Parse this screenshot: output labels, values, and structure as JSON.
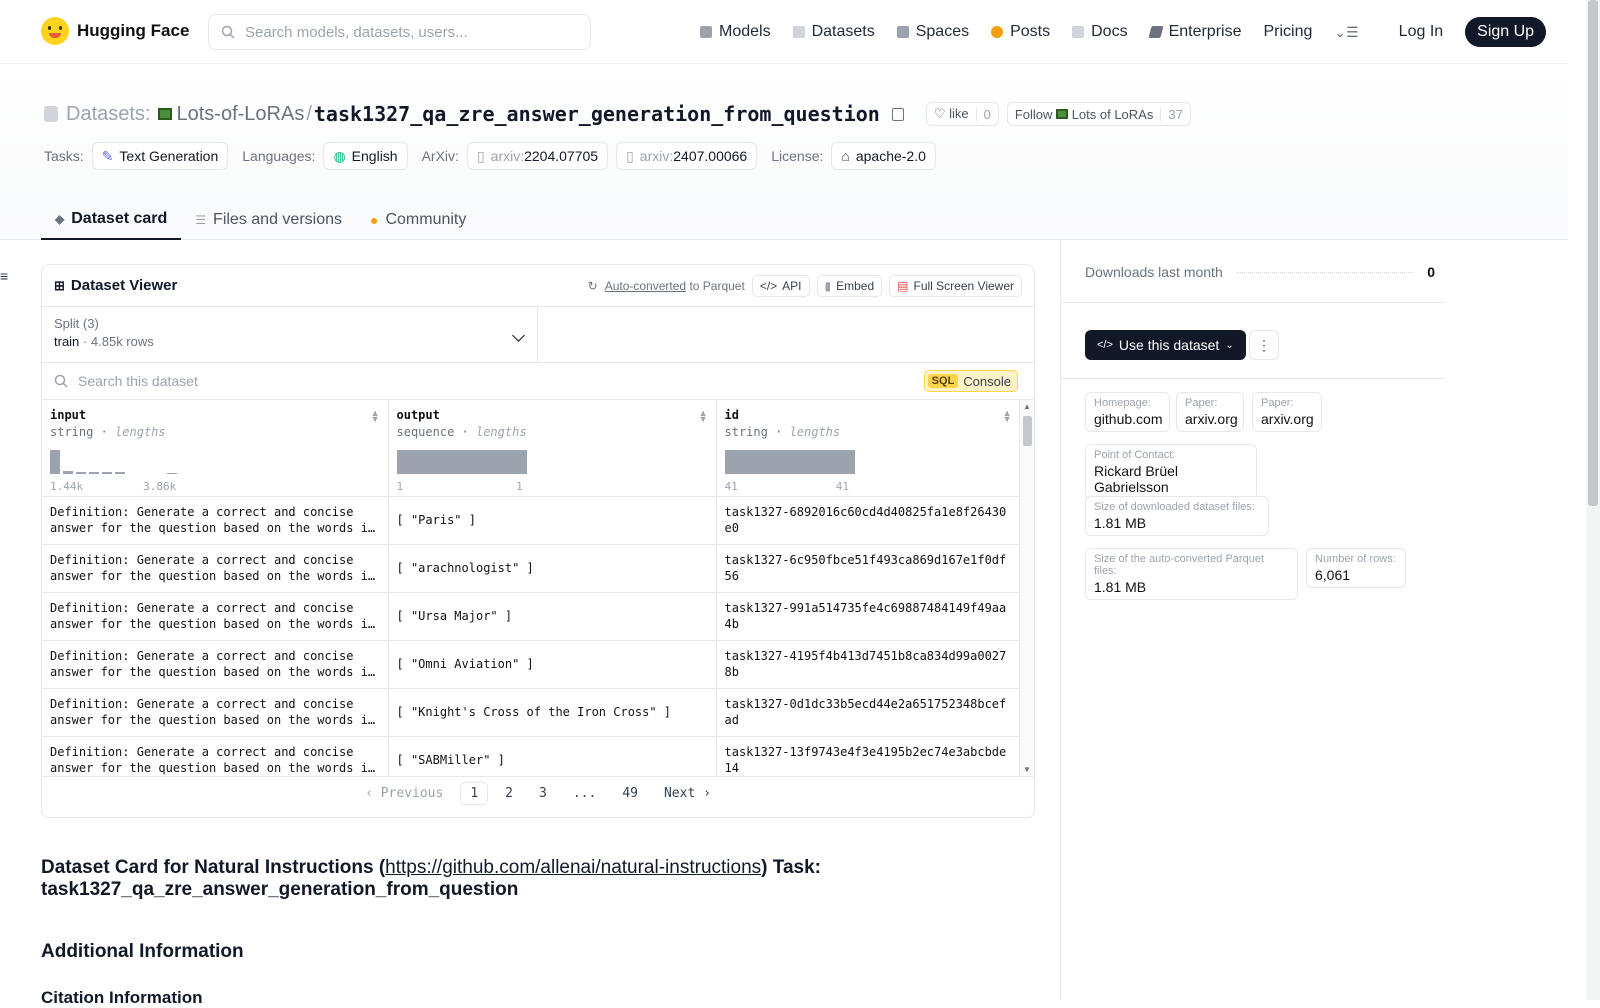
{
  "nav": {
    "brand": "Hugging Face",
    "search_placeholder": "Search models, datasets, users...",
    "items": [
      {
        "label": "Models",
        "color": "#9ca3af"
      },
      {
        "label": "Datasets",
        "color": "#d1d5db"
      },
      {
        "label": "Spaces",
        "color": "#9ca3af"
      },
      {
        "label": "Posts",
        "color": "#f59e0b"
      },
      {
        "label": "Docs",
        "color": "#d1d5db"
      },
      {
        "label": "Enterprise",
        "color": "#6b7280"
      },
      {
        "label": "Pricing",
        "color": ""
      }
    ],
    "login": "Log In",
    "signup": "Sign Up"
  },
  "header": {
    "section": "Datasets:",
    "org": "Lots-of-LoRAs",
    "sep": "/",
    "repo": "task1327_qa_zre_answer_generation_from_question",
    "like_label": "like",
    "like_count": "0",
    "follow_label": "Follow",
    "follow_org": "Lots of LoRAs",
    "follow_count": "37",
    "tasks_label": "Tasks:",
    "task": "Text Generation",
    "languages_label": "Languages:",
    "language": "English",
    "arxiv_label": "ArXiv:",
    "arxiv": [
      {
        "prefix": "arxiv:",
        "id": "2204.07705"
      },
      {
        "prefix": "arxiv:",
        "id": "2407.00066"
      }
    ],
    "license_label": "License:",
    "license": "apache-2.0"
  },
  "tabs": [
    {
      "label": "Dataset card",
      "active": true
    },
    {
      "label": "Files and versions",
      "active": false
    },
    {
      "label": "Community",
      "active": false
    }
  ],
  "viewer": {
    "title": "Dataset Viewer",
    "auto_converted": "Auto-converted",
    "to_parquet": "to Parquet",
    "api": "API",
    "embed": "Embed",
    "fullscreen": "Full Screen Viewer",
    "split_label": "Split (3)",
    "split_name": "train",
    "split_dot": "·",
    "split_rows": "4.85k rows",
    "search_placeholder": "Search this dataset",
    "sql_badge": "SQL",
    "sql_label": "Console",
    "columns": [
      {
        "name": "input",
        "type": "string",
        "stat": "lengths",
        "min": "1.44k",
        "max": "3.86k"
      },
      {
        "name": "output",
        "type": "sequence",
        "stat": "lengths",
        "min": "1",
        "max": "1"
      },
      {
        "name": "id",
        "type": "string",
        "stat": "lengths",
        "min": "41",
        "max": "41"
      }
    ],
    "rows": [
      {
        "input": "Definition: Generate a correct and concise answer for the question based on the words in the context passage.",
        "output": "[ \"Paris\" ]",
        "id": "task1327-6892016c60cd4d40825fa1e8f26430e0"
      },
      {
        "input": "Definition: Generate a correct and concise answer for the question based on the words in the context passage.",
        "output": "[ \"arachnologist\" ]",
        "id": "task1327-6c950fbce51f493ca869d167e1f0df56"
      },
      {
        "input": "Definition: Generate a correct and concise answer for the question based on the words in the context passage.",
        "output": "[ \"Ursa Major\" ]",
        "id": "task1327-991a514735fe4c69887484149f49aa4b"
      },
      {
        "input": "Definition: Generate a correct and concise answer for the question based on the words in the context passage.",
        "output": "[ \"Omni Aviation\" ]",
        "id": "task1327-4195f4b413d7451b8ca834d99a00278b"
      },
      {
        "input": "Definition: Generate a correct and concise answer for the question based on the words in the context passage.",
        "output": "[ \"Knight's Cross of the Iron Cross\" ]",
        "id": "task1327-0d1dc33b5ecd44e2a651752348bcefad"
      },
      {
        "input": "Definition: Generate a correct and concise answer for the question based on the words in the context passage.",
        "output": "[ \"SABMiller\" ]",
        "id": "task1327-13f9743e4f3e4195b2ec74e3abcbde14"
      }
    ],
    "pager": {
      "prev": "Previous",
      "pages": [
        "1",
        "2",
        "3",
        "...",
        "49"
      ],
      "next": "Next"
    }
  },
  "card": {
    "title_prefix": "Dataset Card for Natural Instructions (",
    "title_link": "https://github.com/allenai/natural-instructions",
    "title_suffix": ") Task: task1327_qa_zre_answer_generation_from_question",
    "additional": "Additional Information",
    "citation": "Citation Information"
  },
  "sidebar": {
    "downloads_label": "Downloads last month",
    "downloads": "0",
    "use_button": "Use this dataset",
    "meta": {
      "homepage_k": "Homepage:",
      "homepage_v": "github.com",
      "paper1_k": "Paper:",
      "paper1_v": "arxiv.org",
      "paper2_k": "Paper:",
      "paper2_v": "arxiv.org",
      "contact_k": "Point of Contact:",
      "contact_v": "Rickard Brüel Gabrielsson",
      "size_k": "Size of downloaded dataset files:",
      "size_v": "1.81 MB",
      "parquet_k": "Size of the auto-converted Parquet files:",
      "parquet_v": "1.81 MB",
      "rows_k": "Number of rows:",
      "rows_v": "6,061"
    }
  }
}
